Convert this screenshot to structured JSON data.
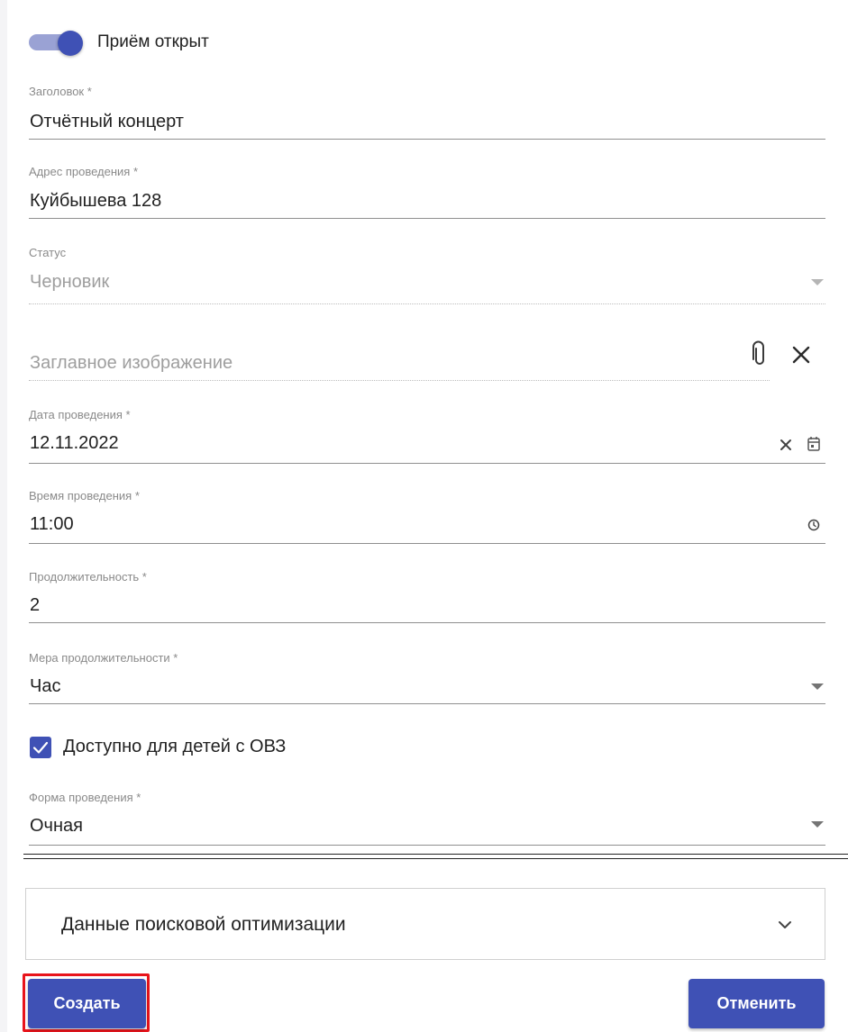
{
  "toggle": {
    "label": "Приём открыт",
    "on": true
  },
  "fields": {
    "title": {
      "label": "Заголовок *",
      "value": "Отчётный концерт"
    },
    "address": {
      "label": "Адрес проведения *",
      "value": "Куйбышева 128"
    },
    "status": {
      "label": "Статус",
      "value": "Черновик"
    },
    "cover_image": {
      "placeholder": "Заглавное изображение"
    },
    "date": {
      "label": "Дата проведения *",
      "value": "12.11.2022"
    },
    "time": {
      "label": "Время проведения *",
      "value": "11:00"
    },
    "duration": {
      "label": "Продолжительность *",
      "value": "2"
    },
    "duration_unit": {
      "label": "Мера продолжительности *",
      "value": "Час"
    },
    "accessible": {
      "label": "Доступно для детей с ОВЗ",
      "checked": true
    },
    "format": {
      "label": "Форма проведения *",
      "value": "Очная"
    }
  },
  "seo": {
    "label": "Данные поисковой оптимизации"
  },
  "buttons": {
    "create": "Создать",
    "cancel": "Отменить"
  },
  "colors": {
    "primary": "#3f51b5",
    "toggle_track": "#9aa2d4",
    "highlight": "#e8141b"
  },
  "icons": [
    "paperclip-icon",
    "close-icon",
    "clear-icon",
    "calendar-icon",
    "clock-icon",
    "dropdown-arrow-icon",
    "checkmark-icon",
    "chevron-down-icon"
  ]
}
